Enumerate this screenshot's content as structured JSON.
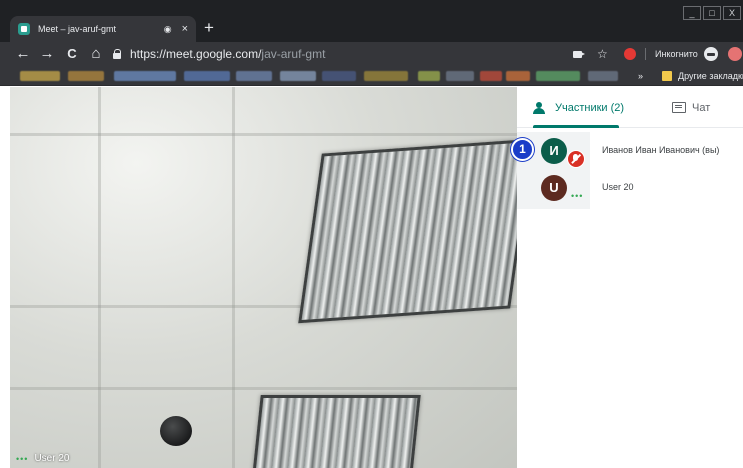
{
  "browser": {
    "tab_title": "Meet – jav-aruf-gmt",
    "tab_record_glyph": "◉",
    "tab_close_glyph": "×",
    "new_tab_glyph": "+",
    "window_controls": [
      "_",
      "□",
      "X"
    ],
    "nav": {
      "back": "←",
      "forward": "→",
      "reload": "C",
      "home": "⌂"
    },
    "url_host": "https://meet.google.com/",
    "url_path": "jav-aruf-gmt",
    "star_glyph": "☆",
    "incognito_label": "Инкогнито",
    "bookmarks_more": "»",
    "other_bookmarks": "Другие закладки"
  },
  "panel": {
    "tab_people_label": "Участники (2)",
    "tab_chat_label": "Чат",
    "participants": [
      {
        "initial": "И",
        "name": "Иванов Иван Иванович (вы)"
      },
      {
        "initial": "U",
        "name": "User 20"
      }
    ]
  },
  "video": {
    "label": "User 20",
    "dots": "•••"
  },
  "step_badge": "1",
  "colors": {
    "accent": "#00796b",
    "mute": "#d93025",
    "badge": "#1a3cc8"
  }
}
